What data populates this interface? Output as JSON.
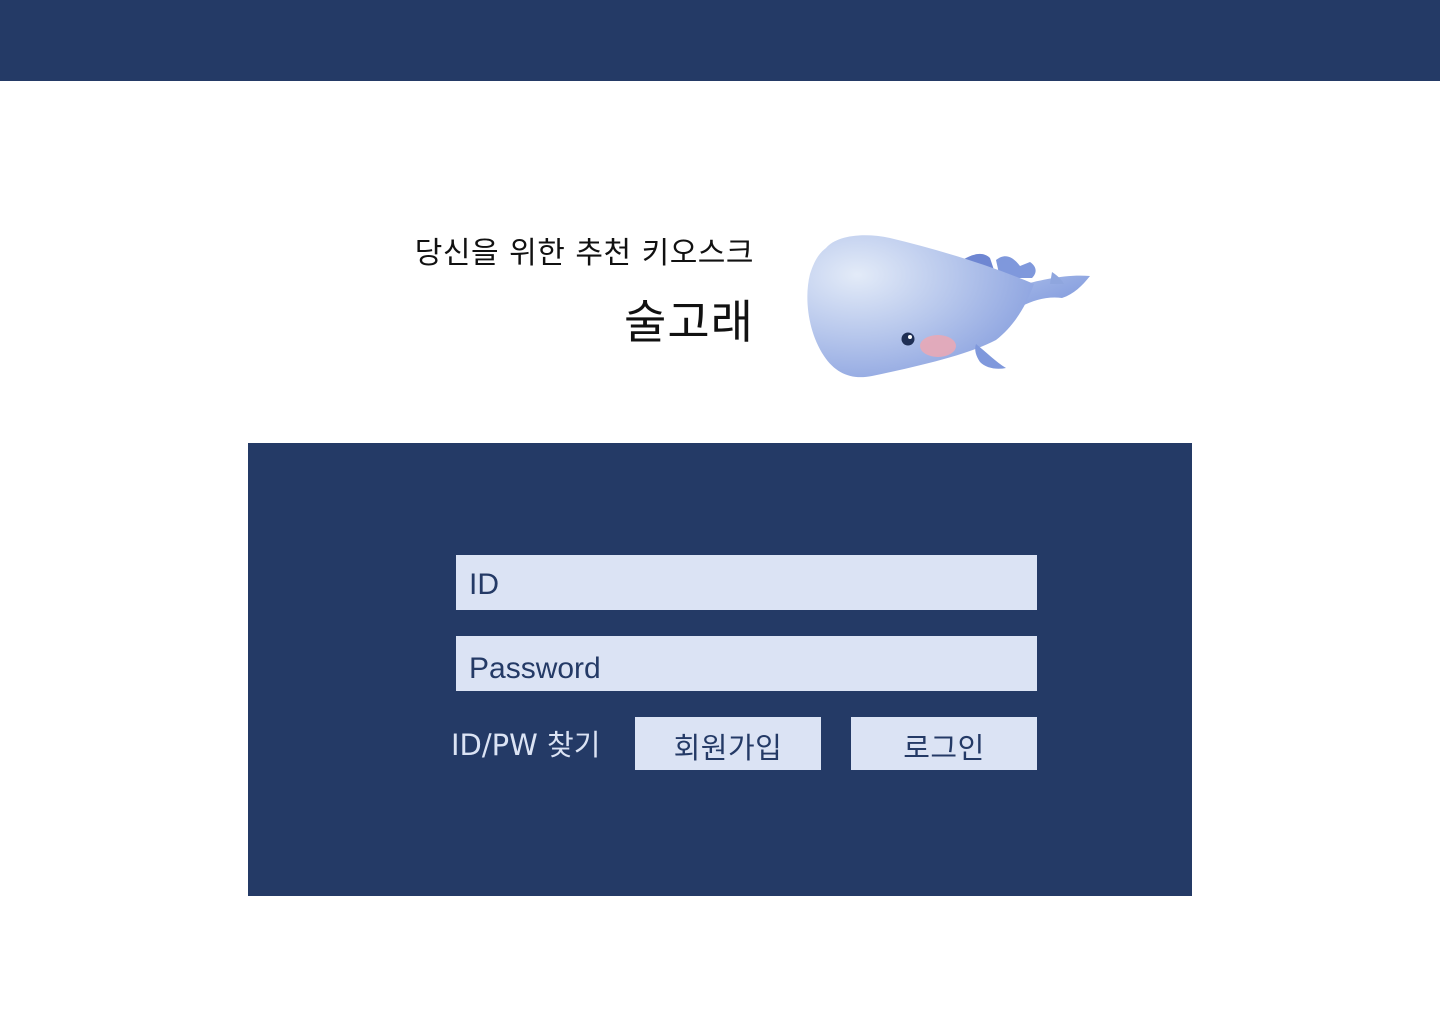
{
  "hero": {
    "tagline": "당신을 위한 추천 키오스크",
    "brand_name": "술고래"
  },
  "login_form": {
    "id_placeholder": "ID",
    "password_placeholder": "Password",
    "find_id_pw_label": "ID/PW 찾기",
    "signup_label": "회원가입",
    "login_label": "로그인"
  },
  "icons": {
    "mascot": "whale-mascot-icon"
  },
  "colors": {
    "navy": "#243a66",
    "light_blue": "#dbe3f4",
    "whale_blue": "#8fa6de",
    "whale_light": "#dde6f6",
    "cheek_pink": "#e8a9b6"
  }
}
